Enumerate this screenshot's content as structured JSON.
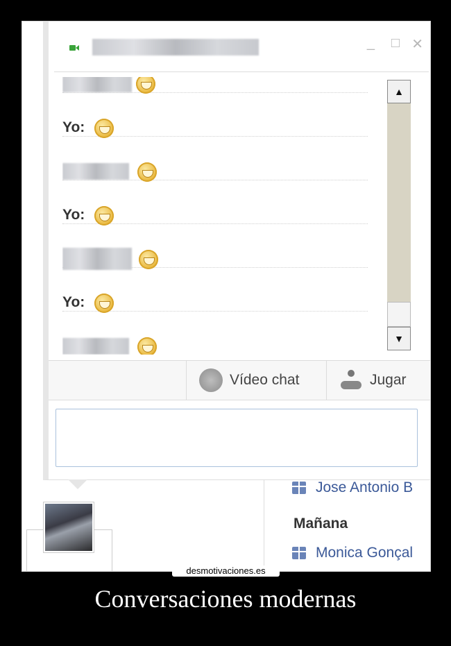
{
  "chat": {
    "messages": [
      {
        "sender": "",
        "blurred": true
      },
      {
        "sender": "Yo:",
        "blurred": false
      },
      {
        "sender": "",
        "blurred": true
      },
      {
        "sender": "Yo:",
        "blurred": false
      },
      {
        "sender": "",
        "blurred": true
      },
      {
        "sender": "Yo:",
        "blurred": false
      },
      {
        "sender": "",
        "blurred": true
      }
    ],
    "actions": {
      "video_chat": "Vídeo chat",
      "play": "Jugar"
    }
  },
  "window_controls": {
    "minimize": "_",
    "maximize": "□",
    "close": "✕"
  },
  "sidebar": {
    "birthday_1": "Jose Antonio B",
    "day_heading": "Mañana",
    "birthday_2": "Monica Gonçal"
  },
  "watermark": "desmotivaciones.es",
  "caption": "Conversaciones modernas",
  "colors": {
    "link": "#3b5998",
    "camera_icon": "#3aa43a",
    "smiley": "#e9b73c"
  }
}
